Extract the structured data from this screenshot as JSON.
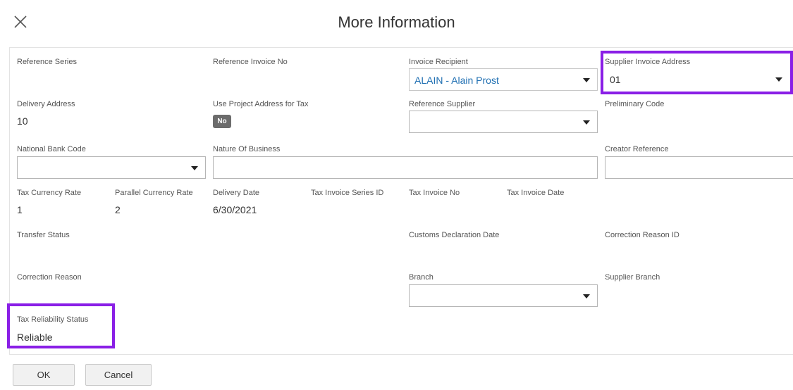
{
  "header": {
    "title": "More Information"
  },
  "fields": {
    "reference_series": {
      "label": "Reference Series"
    },
    "reference_invoice_no": {
      "label": "Reference Invoice No"
    },
    "invoice_recipient": {
      "label": "Invoice Recipient",
      "value": "ALAIN - Alain Prost"
    },
    "supplier_invoice_address": {
      "label": "Supplier Invoice Address",
      "value": "01"
    },
    "delivery_address": {
      "label": "Delivery Address",
      "value": "10"
    },
    "use_project_address_for_tax": {
      "label": "Use Project Address for Tax",
      "value": "No"
    },
    "reference_supplier": {
      "label": "Reference Supplier",
      "value": ""
    },
    "preliminary_code": {
      "label": "Preliminary Code"
    },
    "national_bank_code": {
      "label": "National Bank Code",
      "value": ""
    },
    "nature_of_business": {
      "label": "Nature Of Business",
      "value": ""
    },
    "creator_reference": {
      "label": "Creator Reference",
      "value": ""
    },
    "tax_currency_rate": {
      "label": "Tax Currency Rate",
      "value": "1"
    },
    "parallel_currency_rate": {
      "label": "Parallel Currency Rate",
      "value": "2"
    },
    "delivery_date": {
      "label": "Delivery Date",
      "value": "6/30/2021"
    },
    "tax_invoice_series_id": {
      "label": "Tax Invoice Series ID"
    },
    "tax_invoice_no": {
      "label": "Tax Invoice No"
    },
    "tax_invoice_date": {
      "label": "Tax Invoice Date"
    },
    "transfer_status": {
      "label": "Transfer Status"
    },
    "customs_declaration_date": {
      "label": "Customs Declaration Date"
    },
    "correction_reason_id": {
      "label": "Correction Reason ID"
    },
    "correction_reason": {
      "label": "Correction Reason"
    },
    "branch": {
      "label": "Branch",
      "value": ""
    },
    "supplier_branch": {
      "label": "Supplier Branch"
    },
    "tax_reliability_status": {
      "label": "Tax Reliability Status",
      "value": "Reliable"
    }
  },
  "footer": {
    "ok_label": "OK",
    "cancel_label": "Cancel"
  },
  "colors": {
    "highlight": "#8a1fe6",
    "link_value": "#1f6fb2",
    "toggle_bg": "#6c6c6c"
  },
  "icons": {
    "close": "close-icon",
    "dropdown": "chevron-down-icon"
  }
}
